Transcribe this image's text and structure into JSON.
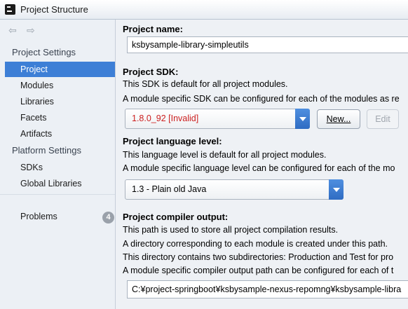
{
  "window": {
    "title": "Project Structure"
  },
  "sidebar": {
    "project_settings_header": "Project Settings",
    "project_items": [
      {
        "label": "Project"
      },
      {
        "label": "Modules"
      },
      {
        "label": "Libraries"
      },
      {
        "label": "Facets"
      },
      {
        "label": "Artifacts"
      }
    ],
    "platform_settings_header": "Platform Settings",
    "platform_items": [
      {
        "label": "SDKs"
      },
      {
        "label": "Global Libraries"
      }
    ],
    "problems": {
      "label": "Problems",
      "count": "4"
    },
    "selected": "Project"
  },
  "project_name": {
    "label": "Project name:",
    "value": "ksbysample-library-simpleutils"
  },
  "project_sdk": {
    "label": "Project SDK:",
    "desc1": "This SDK is default for all project modules.",
    "desc2": "A module specific SDK can be configured for each of the modules as re",
    "selected": "1.8.0_92 [Invalid]",
    "selected_color": "#cc1f1f",
    "new_button": "New...",
    "edit_button": "Edit"
  },
  "language_level": {
    "label": "Project language level:",
    "desc1": "This language level is default for all project modules.",
    "desc2": "A module specific language level can be configured for each of the mo",
    "selected": "1.3 - Plain old Java"
  },
  "compiler_output": {
    "label": "Project compiler output:",
    "desc1": "This path is used to store all project compilation results.",
    "desc2": "A directory corresponding to each module is created under this path.",
    "desc3": "This directory contains two subdirectories: Production and Test for pro",
    "desc4": "A module specific compiler output path can be configured for each of t",
    "path": "C:¥project-springboot¥ksbysample-nexus-repomng¥ksbysample-libra"
  },
  "colors": {
    "accent": "#3d7fd6"
  }
}
